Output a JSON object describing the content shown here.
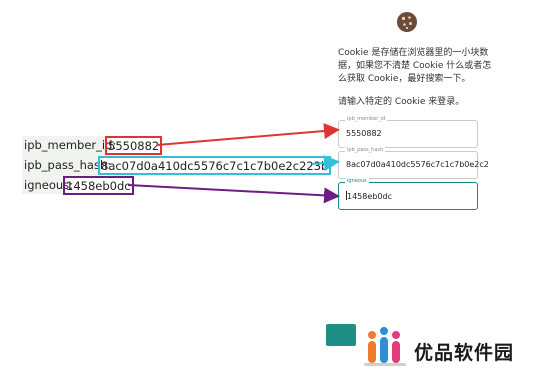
{
  "dialog": {
    "description": "Cookie 是存储在浏览器里的一小块数据，如果您不清楚 Cookie 什么或者怎么获取 Cookie，最好搜索一下。",
    "instruction": "请输入特定的 Cookie 来登录。"
  },
  "fields": [
    {
      "label": "ipb_member_id",
      "value": "5550882"
    },
    {
      "label": "ipb_pass_hash",
      "value": "8ac07d0a410dc5576c7c1c7b0e2c2"
    },
    {
      "label": "igneous",
      "value": "1458eb0dc"
    }
  ],
  "annotations": [
    {
      "key": "ipb_member_id:",
      "value": "5550882",
      "color": "#e03434"
    },
    {
      "key": "ipb_pass_hash:",
      "value": "8ac07d0a410dc5576c7c1c7b0e2c223b",
      "color": "#33bfd8"
    },
    {
      "key": "igneous:",
      "value": "1458eb0dc",
      "color": "#6c1d85"
    }
  ],
  "submit_button": {
    "color": "#1f8f86"
  },
  "watermark": {
    "text": "优品软件园",
    "icon": "people-logo-icon"
  }
}
